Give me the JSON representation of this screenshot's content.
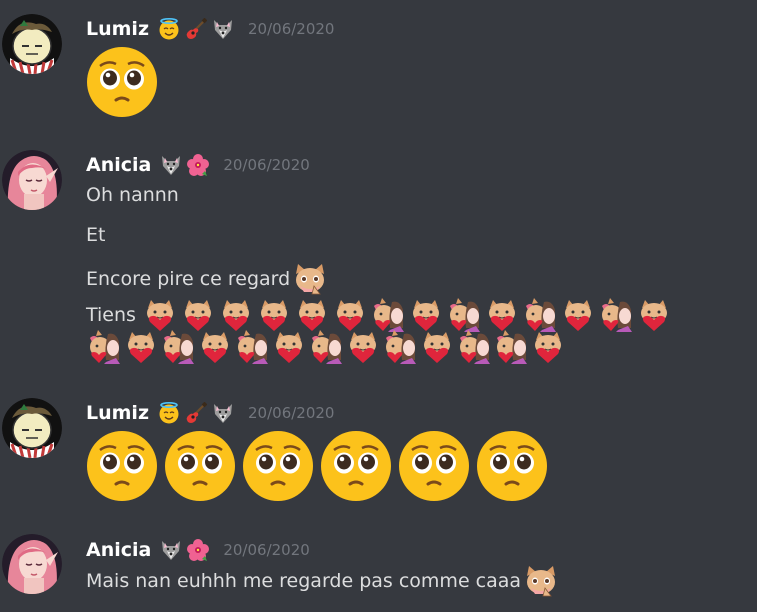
{
  "messages": [
    {
      "username": "Lumiz",
      "badges": [
        "smiling-face-with-halo",
        "guitar",
        "wolf-face"
      ],
      "timestamp": "20/06/2020",
      "content": "pleading-face emoji x1"
    },
    {
      "username": "Anicia",
      "badges": [
        "wolf-face",
        "hibiscus"
      ],
      "timestamp": "20/06/2020",
      "lines": [
        "Oh nannn",
        "Et",
        "Encore pire ce regard",
        "Tiens"
      ]
    },
    {
      "username": "Lumiz",
      "badges": [
        "smiling-face-with-halo",
        "guitar",
        "wolf-face"
      ],
      "timestamp": "20/06/2020",
      "content": "pleading-face emoji x6"
    },
    {
      "username": "Anicia",
      "badges": [
        "wolf-face",
        "hibiscus"
      ],
      "timestamp": "20/06/2020",
      "lines": [
        "Mais nan euhhh me regarde pas comme caaa"
      ]
    }
  ],
  "colors": {
    "background": "#36393f",
    "username": "#ffffff",
    "text": "#dcddde",
    "timestamp": "#72767d"
  }
}
